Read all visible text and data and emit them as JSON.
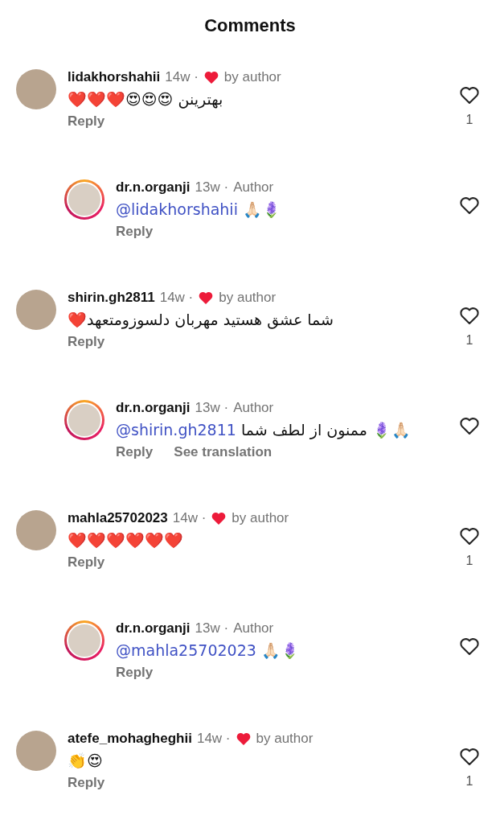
{
  "header": {
    "title": "Comments"
  },
  "comments": [
    {
      "kind": "comment",
      "username": "lidakhorshahii",
      "time": "14w ·",
      "liked_by_author": true,
      "badge": "by author",
      "text": "بهترینن 😍😍😍❤️❤️❤️",
      "reply": "Reply",
      "likes": "1",
      "story_ring": false
    },
    {
      "kind": "reply",
      "username": "dr.n.organji",
      "time": "13w ·",
      "liked_by_author": false,
      "badge": "Author",
      "mention": "@lidakhorshahii",
      "text": "🙏🏻🪻",
      "reply": "Reply",
      "story_ring": true
    },
    {
      "kind": "comment",
      "username": "shirin.gh2811",
      "time": "14w ·",
      "liked_by_author": true,
      "badge": "by author",
      "text": "شما عشق هستید مهربان دلسوزومتعهد❤️",
      "reply": "Reply",
      "likes": "1",
      "story_ring": false
    },
    {
      "kind": "reply",
      "username": "dr.n.organji",
      "time": "13w ·",
      "liked_by_author": false,
      "badge": "Author",
      "mention": "@shirin.gh2811",
      "text": "ممنون از لطف شما 🪻🙏🏻",
      "reply": "Reply",
      "translation": "See translation",
      "story_ring": true
    },
    {
      "kind": "comment",
      "username": "mahla25702023",
      "time": "14w ·",
      "liked_by_author": true,
      "badge": "by author",
      "text": "❤️❤️❤️❤️❤️❤️",
      "reply": "Reply",
      "likes": "1",
      "story_ring": false
    },
    {
      "kind": "reply",
      "username": "dr.n.organji",
      "time": "13w ·",
      "liked_by_author": false,
      "badge": "Author",
      "mention": "@mahla25702023",
      "text": "🙏🏻🪻",
      "reply": "Reply",
      "story_ring": true
    },
    {
      "kind": "comment",
      "username": "atefe_mohagheghii",
      "time": "14w ·",
      "liked_by_author": true,
      "badge": "by author",
      "text": "👏😍",
      "reply": "Reply",
      "likes": "1",
      "story_ring": false
    }
  ]
}
